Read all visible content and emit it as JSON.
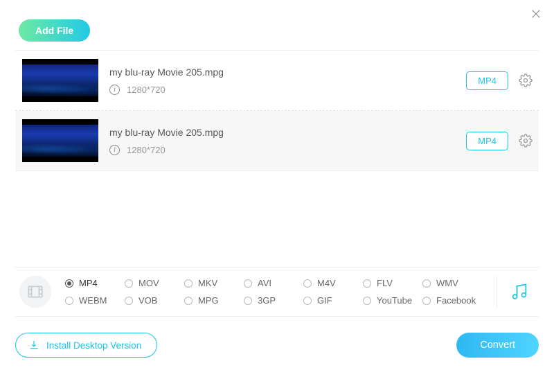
{
  "header": {
    "add_file_label": "Add File"
  },
  "files": [
    {
      "name": "my blu-ray Movie 205.mpg",
      "resolution": "1280*720",
      "format_label": "MP4"
    },
    {
      "name": "my blu-ray Movie 205.mpg",
      "resolution": "1280*720",
      "format_label": "MP4"
    }
  ],
  "formats": {
    "selected": "MP4",
    "options": [
      "MP4",
      "MOV",
      "MKV",
      "AVI",
      "M4V",
      "FLV",
      "WMV",
      "WEBM",
      "VOB",
      "MPG",
      "3GP",
      "GIF",
      "YouTube",
      "Facebook"
    ]
  },
  "footer": {
    "install_label": "Install Desktop Version",
    "convert_label": "Convert"
  }
}
